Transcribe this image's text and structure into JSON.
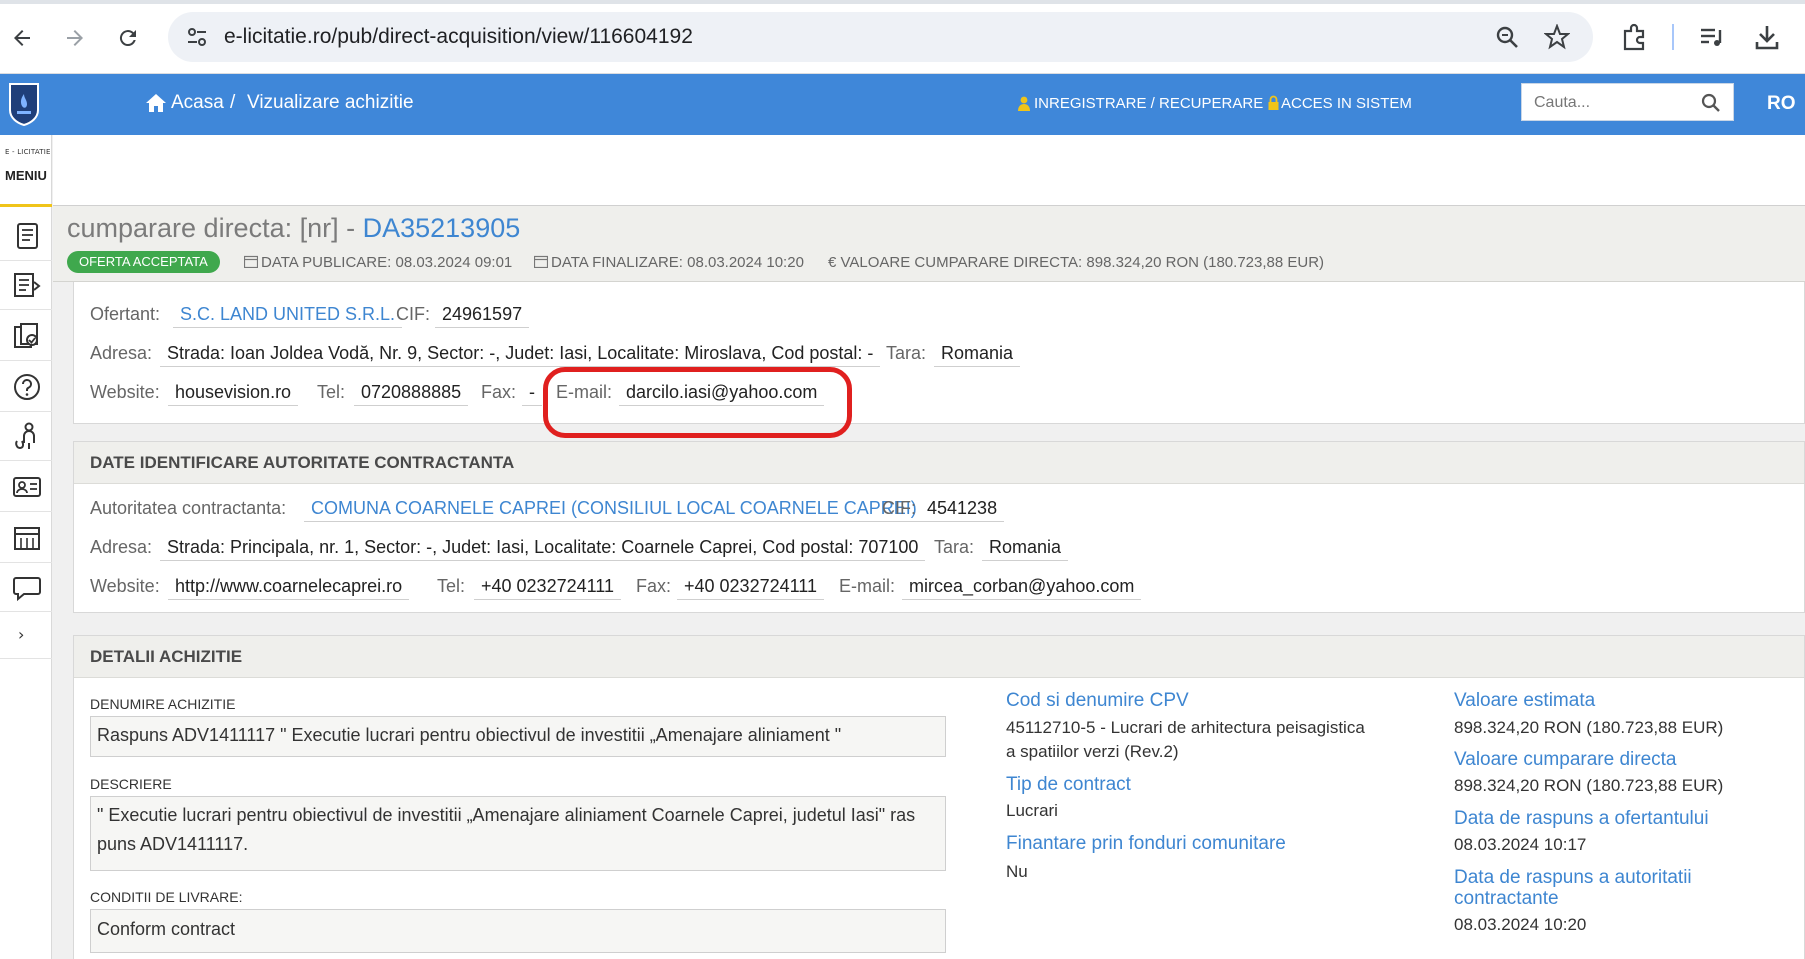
{
  "browser": {
    "url": "e-licitatie.ro/pub/direct-acquisition/view/116604192"
  },
  "header": {
    "home_label": "Acasa",
    "separator": "/",
    "current_page": "Vizualizare achizitie",
    "register_label": "INREGISTRARE / RECUPERARE",
    "login_label": "ACCES IN SISTEM",
    "search_placeholder": "Cauta...",
    "language": "RO",
    "brand_color": "#3f87d9"
  },
  "sidebar": {
    "small_label": "E - LICITATIE",
    "menu_label": "MENIU",
    "icons": [
      "document-icon",
      "list-export-icon",
      "certificate-icon",
      "help-icon",
      "user-tree-icon",
      "id-card-icon",
      "calendar-icon",
      "chat-icon"
    ],
    "expand": "›"
  },
  "title": {
    "prefix": "cumparare directa: [nr] - ",
    "code": "DA35213905",
    "status": "OFERTA ACCEPTATA",
    "publish": "DATA PUBLICARE: 08.03.2024 09:01",
    "finish": "DATA FINALIZARE: 08.03.2024 10:20",
    "value": "€ VALOARE CUMPARARE DIRECTA: 898.324,20  RON (180.723,88  EUR)"
  },
  "offerer": {
    "name_label": "Ofertant:",
    "name": "S.C. LAND UNITED S.R.L.",
    "cif_label": "CIF:",
    "cif": "24961597",
    "address_label": "Adresa:",
    "address": "Strada: Ioan Joldea Vodă, Nr. 9, Sector: -, Judet: Iasi, Localitate: Miroslava, Cod postal: -",
    "country_label": "Tara:",
    "country": "Romania",
    "website_label": "Website:",
    "website": "housevision.ro",
    "tel_label": "Tel:",
    "tel": "0720888885",
    "fax_label": "Fax:",
    "fax": "-",
    "email_label": "E-mail:",
    "email": "darcilo.iasi@yahoo.com"
  },
  "authority": {
    "heading": "DATE IDENTIFICARE AUTORITATE CONTRACTANTA",
    "name_label": "Autoritatea contractanta:",
    "name": "COMUNA COARNELE CAPREI (CONSILIUL LOCAL COARNELE CAPREI)",
    "cif_label": "CIF:",
    "cif": "4541238",
    "address_label": "Adresa:",
    "address": "Strada: Principala, nr. 1, Sector: -, Judet: Iasi, Localitate: Coarnele Caprei, Cod postal: 707100",
    "country_label": "Tara:",
    "country": "Romania",
    "website_label": "Website:",
    "website": "http://www.coarnelecaprei.ro",
    "tel_label": "Tel:",
    "tel": "+40 0232724111",
    "fax_label": "Fax:",
    "fax": "+40 0232724111",
    "email_label": "E-mail:",
    "email": "mircea_corban@yahoo.com"
  },
  "details": {
    "heading": "DETALII ACHIZITIE",
    "name_label": "DENUMIRE ACHIZITIE",
    "name": "Raspuns ADV1411117 \" Executie lucrari pentru obiectivul de investitii „Amenajare aliniament \"",
    "desc_label": "DESCRIERE",
    "desc": "\" Executie lucrari pentru obiectivul de investitii „Amenajare aliniament Coarnele Caprei, judetul Iasi\" ras puns ADV1411117.",
    "delivery_label": "CONDITII DE LIVRARE:",
    "delivery": "Conform contract",
    "cpv_title": "Cod si denumire CPV",
    "cpv_line1": "45112710-5 - Lucrari de arhitectura peisagistica",
    "cpv_line2": "a spatiilor verzi (Rev.2)",
    "contract_title": "Tip de contract",
    "contract": "Lucrari",
    "funding_title": "Finantare prin fonduri comunitare",
    "funding": "Nu",
    "est_title": "Valoare estimata",
    "est": "898.324,20  RON (180.723,88  EUR)",
    "direct_title": "Valoare cumparare directa",
    "direct": "898.324,20  RON (180.723,88  EUR)",
    "offer_reply_title": "Data de raspuns a ofertantului",
    "offer_reply": "08.03.2024 10:17",
    "auth_reply_title1": "Data de raspuns a autoritatii",
    "auth_reply_title2": "contractante",
    "auth_reply": "08.03.2024 10:20"
  }
}
